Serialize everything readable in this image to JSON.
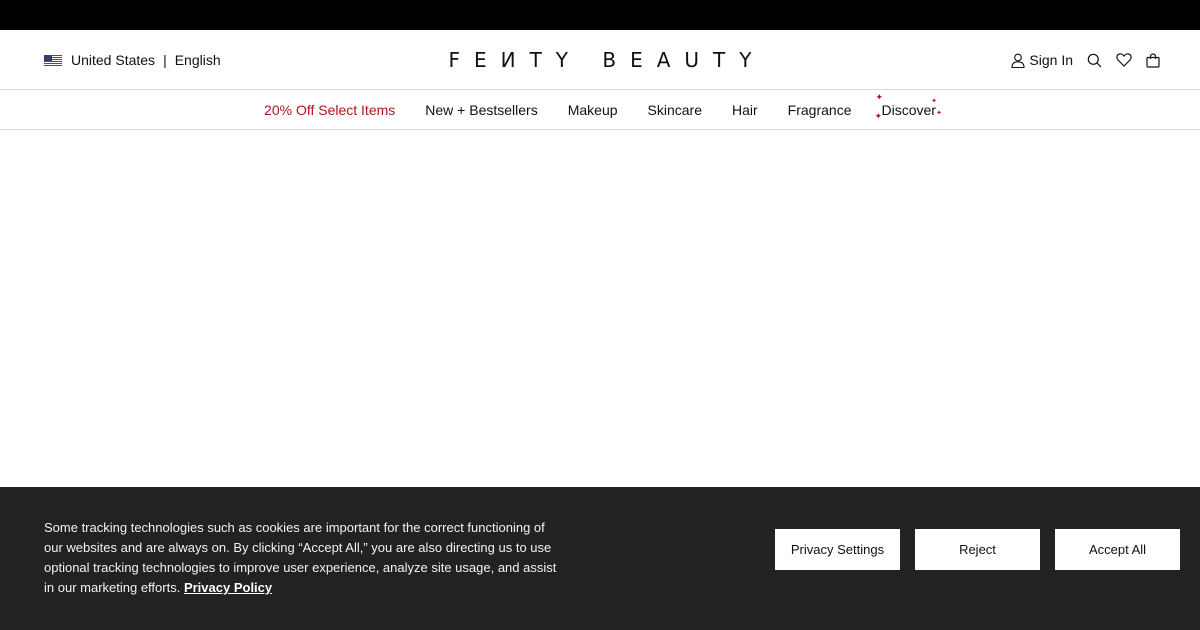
{
  "header": {
    "locale": {
      "country": "United States",
      "separator": "|",
      "language": "English",
      "flag_icon": "us-flag-icon"
    },
    "logo_text": "FEИTY BEAUTY",
    "sign_in_label": "Sign In",
    "icons": [
      "user-icon",
      "search-icon",
      "heart-icon",
      "bag-icon"
    ]
  },
  "nav": {
    "items": [
      {
        "label": "20% Off Select Items",
        "color": "#b0151e"
      },
      {
        "label": "New + Bestsellers"
      },
      {
        "label": "Makeup"
      },
      {
        "label": "Skincare"
      },
      {
        "label": "Hair"
      },
      {
        "label": "Fragrance"
      },
      {
        "label": "Discover"
      }
    ],
    "sparkle_color": "#b0151e"
  },
  "cookie_banner": {
    "text": "Some tracking technologies such as cookies are important for the correct functioning of our websites and are always on. By clicking “Accept All,” you are also directing us to use optional tracking technologies to improve user experience, analyze site usage, and assist in our marketing efforts.",
    "policy_link": "Privacy Policy",
    "buttons": {
      "privacy_settings": "Privacy Settings",
      "reject": "Reject",
      "accept_all": "Accept All"
    },
    "background": "#222222"
  }
}
